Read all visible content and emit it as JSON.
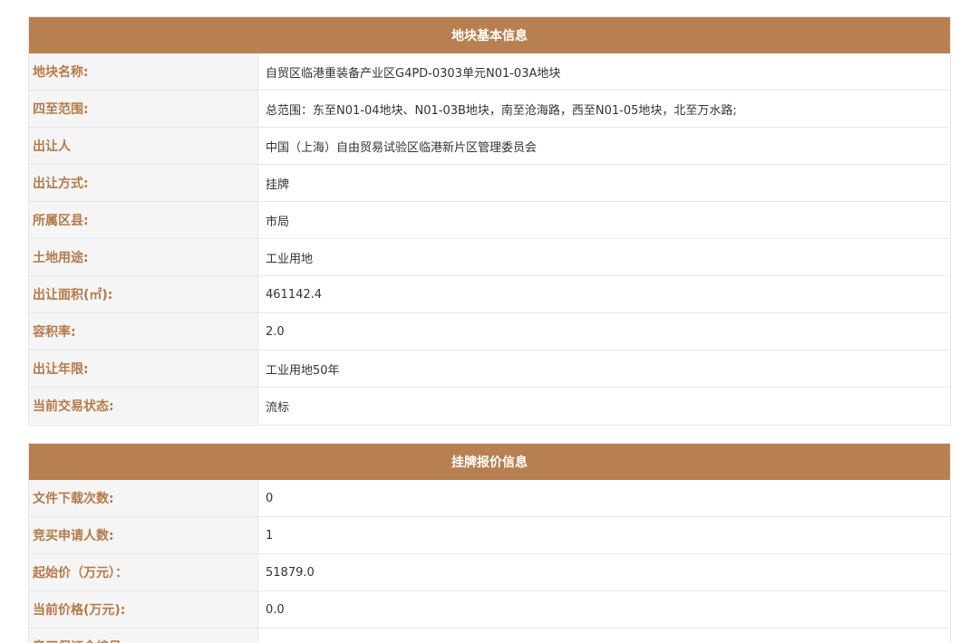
{
  "panel_basic": {
    "title": "地块基本信息",
    "rows": [
      {
        "label": "地块名称:",
        "value": "自贸区临港重装备产业区G4PD-0303单元N01-03A地块"
      },
      {
        "label": "四至范围:",
        "value": "总范围：东至N01-04地块、N01-03B地块，南至沧海路，西至N01-05地块，北至万水路;"
      },
      {
        "label": "出让人",
        "value": "中国（上海）自由贸易试验区临港新片区管理委员会"
      },
      {
        "label": "出让方式:",
        "value": "挂牌"
      },
      {
        "label": "所属区县:",
        "value": "市局"
      },
      {
        "label": "土地用途:",
        "value": "工业用地"
      },
      {
        "label": "出让面积(㎡):",
        "value": "461142.4"
      },
      {
        "label": "容积率:",
        "value": "2.0"
      },
      {
        "label": "出让年限:",
        "value": "工业用地50年"
      },
      {
        "label": "当前交易状态:",
        "value": "流标"
      }
    ]
  },
  "panel_listing": {
    "title": "挂牌报价信息",
    "rows": [
      {
        "label": "文件下载次数:",
        "value": "0"
      },
      {
        "label": "竞买申请人数:",
        "value": "1"
      },
      {
        "label": "起始价（万元）：",
        "value": "51879.0"
      },
      {
        "label": "当前价格(万元):",
        "value": "0.0"
      },
      {
        "label": "竞买保证金编号",
        "value": ""
      }
    ]
  },
  "colors": {
    "header_bg": "#b88050",
    "label_text": "#b57a47",
    "label_bg": "#f5f5f5"
  }
}
